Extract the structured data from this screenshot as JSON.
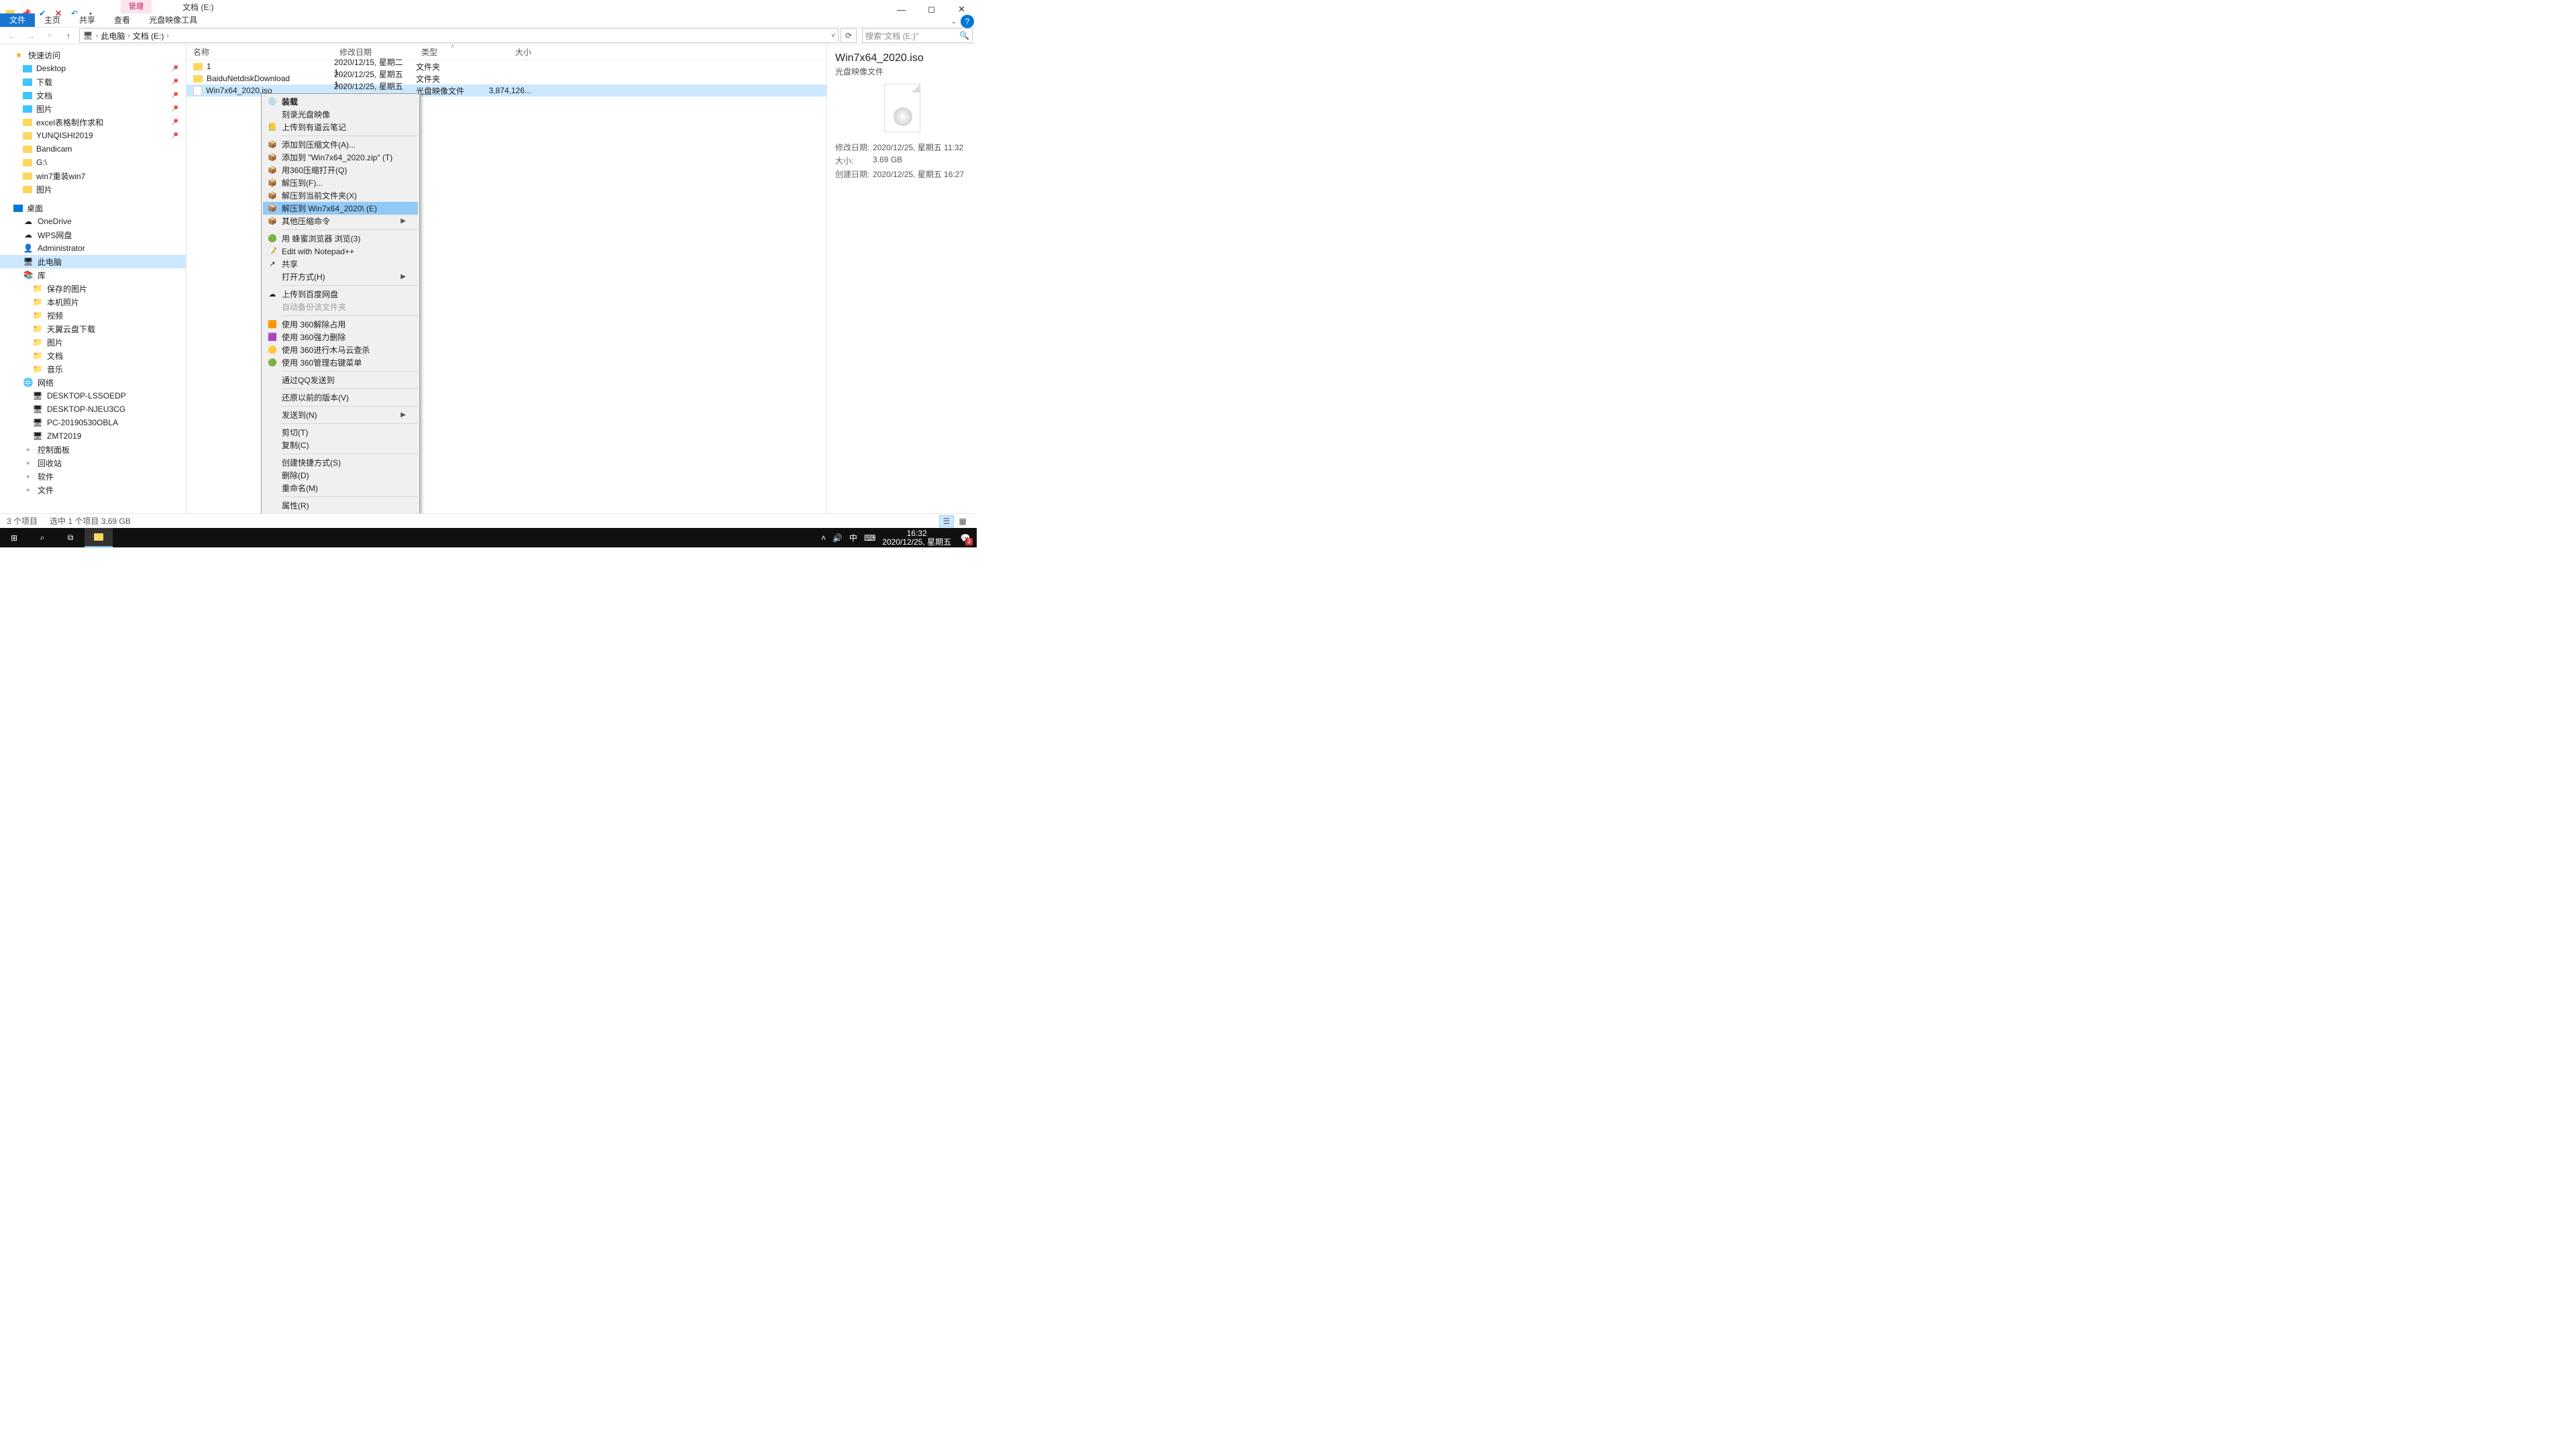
{
  "window": {
    "contextual_tab": "管理",
    "title": "文档 (E:)",
    "ribbon_tabs": {
      "file": "文件",
      "home": "主页",
      "share": "共享",
      "view": "查看",
      "disc_tools": "光盘映像工具"
    }
  },
  "breadcrumb": {
    "root": "此电脑",
    "current": "文档 (E:)"
  },
  "search": {
    "placeholder": "搜索\"文档 (E:)\""
  },
  "sidebar": {
    "quick_access": "快速访问",
    "items_qa": [
      {
        "label": "Desktop"
      },
      {
        "label": "下载"
      },
      {
        "label": "文档"
      },
      {
        "label": "图片"
      },
      {
        "label": "excel表格制作求和"
      },
      {
        "label": "YUNQISHI2019"
      },
      {
        "label": "Bandicam"
      },
      {
        "label": "G:\\"
      },
      {
        "label": "win7重装win7"
      },
      {
        "label": "图片"
      }
    ],
    "desktop": "桌面",
    "items_dt": [
      {
        "label": "OneDrive"
      },
      {
        "label": "WPS网盘"
      },
      {
        "label": "Administrator"
      },
      {
        "label": "此电脑"
      },
      {
        "label": "库"
      }
    ],
    "items_lib": [
      {
        "label": "保存的图片"
      },
      {
        "label": "本机照片"
      },
      {
        "label": "视频"
      },
      {
        "label": "天翼云盘下载"
      },
      {
        "label": "图片"
      },
      {
        "label": "文档"
      },
      {
        "label": "音乐"
      }
    ],
    "network": "网络",
    "items_net": [
      {
        "label": "DESKTOP-LSSOEDP"
      },
      {
        "label": "DESKTOP-NJEU3CG"
      },
      {
        "label": "PC-20190530OBLA"
      },
      {
        "label": "ZMT2019"
      }
    ],
    "items_misc": [
      {
        "label": "控制面板"
      },
      {
        "label": "回收站"
      },
      {
        "label": "软件"
      },
      {
        "label": "文件"
      }
    ]
  },
  "columns": {
    "name": "名称",
    "date": "修改日期",
    "type": "类型",
    "size": "大小"
  },
  "files": [
    {
      "name": "1",
      "date": "2020/12/15, 星期二 1...",
      "type": "文件夹",
      "size": ""
    },
    {
      "name": "BaiduNetdiskDownload",
      "date": "2020/12/25, 星期五 1...",
      "type": "文件夹",
      "size": ""
    },
    {
      "name": "Win7x64_2020.iso",
      "date": "2020/12/25, 星期五 1...",
      "type": "光盘映像文件",
      "size": "3,874,126..."
    }
  ],
  "context_menu": [
    {
      "t": "item",
      "label": "装载",
      "bold": true,
      "icon": "disc"
    },
    {
      "t": "item",
      "label": "刻录光盘映像"
    },
    {
      "t": "item",
      "label": "上传到有道云笔记",
      "icon": "youdao"
    },
    {
      "t": "sep"
    },
    {
      "t": "item",
      "label": "添加到压缩文件(A)...",
      "icon": "zip"
    },
    {
      "t": "item",
      "label": "添加到 \"Win7x64_2020.zip\" (T)",
      "icon": "zip"
    },
    {
      "t": "item",
      "label": "用360压缩打开(Q)",
      "icon": "zip"
    },
    {
      "t": "item",
      "label": "解压到(F)...",
      "icon": "zip"
    },
    {
      "t": "item",
      "label": "解压到当前文件夹(X)",
      "icon": "zip"
    },
    {
      "t": "item",
      "label": "解压到 Win7x64_2020\\ (E)",
      "icon": "zip",
      "hover": true
    },
    {
      "t": "item",
      "label": "其他压缩命令",
      "icon": "zip",
      "submenu": true
    },
    {
      "t": "sep"
    },
    {
      "t": "item",
      "label": "用 蜂蜜浏览器 浏览(3)",
      "icon": "green"
    },
    {
      "t": "item",
      "label": "Edit with Notepad++",
      "icon": "npp"
    },
    {
      "t": "item",
      "label": "共享",
      "icon": "share"
    },
    {
      "t": "item",
      "label": "打开方式(H)",
      "submenu": true
    },
    {
      "t": "sep"
    },
    {
      "t": "item",
      "label": "上传到百度网盘",
      "icon": "baidu"
    },
    {
      "t": "item",
      "label": "自动备份该文件夹",
      "disabled": true
    },
    {
      "t": "sep"
    },
    {
      "t": "item",
      "label": "使用 360解除占用",
      "icon": "360o"
    },
    {
      "t": "item",
      "label": "使用 360强力删除",
      "icon": "360p"
    },
    {
      "t": "item",
      "label": "使用 360进行木马云查杀",
      "icon": "360y"
    },
    {
      "t": "item",
      "label": "使用 360管理右键菜单",
      "icon": "360g"
    },
    {
      "t": "sep"
    },
    {
      "t": "item",
      "label": "通过QQ发送到"
    },
    {
      "t": "sep"
    },
    {
      "t": "item",
      "label": "还原以前的版本(V)"
    },
    {
      "t": "sep"
    },
    {
      "t": "item",
      "label": "发送到(N)",
      "submenu": true
    },
    {
      "t": "sep"
    },
    {
      "t": "item",
      "label": "剪切(T)"
    },
    {
      "t": "item",
      "label": "复制(C)"
    },
    {
      "t": "sep"
    },
    {
      "t": "item",
      "label": "创建快捷方式(S)"
    },
    {
      "t": "item",
      "label": "删除(D)"
    },
    {
      "t": "item",
      "label": "重命名(M)"
    },
    {
      "t": "sep"
    },
    {
      "t": "item",
      "label": "属性(R)"
    }
  ],
  "details": {
    "title": "Win7x64_2020.iso",
    "subtitle": "光盘映像文件",
    "rows": [
      {
        "k": "修改日期:",
        "v": "2020/12/25, 星期五 11:32"
      },
      {
        "k": "大小:",
        "v": "3.69 GB"
      },
      {
        "k": "创建日期:",
        "v": "2020/12/25, 星期五 16:27"
      }
    ]
  },
  "statusbar": {
    "count": "3 个项目",
    "selection": "选中 1 个项目  3.69 GB"
  },
  "taskbar": {
    "time": "16:32",
    "date": "2020/12/25, 星期五",
    "notif_count": "3",
    "ime": "中"
  }
}
